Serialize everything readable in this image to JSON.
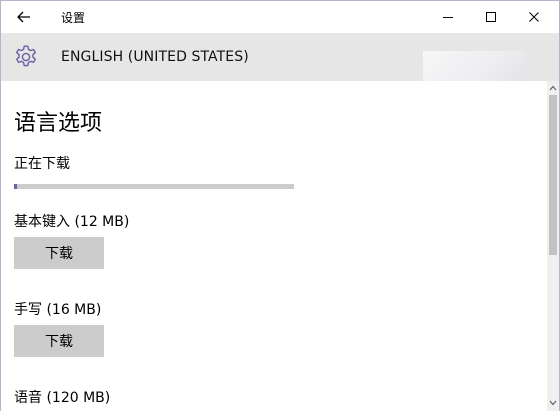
{
  "window": {
    "title": "设置",
    "controls": [
      "minimize",
      "maximize",
      "close"
    ]
  },
  "header": {
    "icon": "gear-icon",
    "title": "ENGLISH (UNITED STATES)",
    "accent_color": "#6b5fa6"
  },
  "page": {
    "title": "语言选项",
    "downloading": {
      "label": "正在下载",
      "progress": 0.01
    },
    "items": [
      {
        "label": "基本键入 (12 MB)",
        "button": "下载"
      },
      {
        "label": "手写 (16 MB)",
        "button": "下载"
      },
      {
        "label": "语音 (120 MB)"
      }
    ]
  }
}
